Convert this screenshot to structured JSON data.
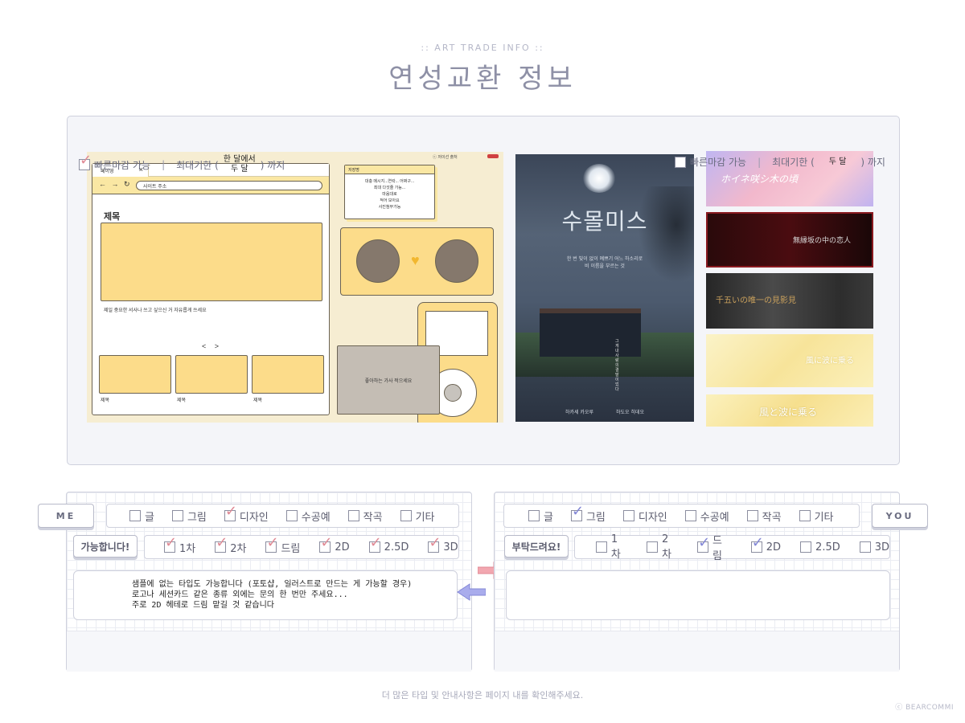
{
  "header": {
    "subtitle": ":: ART TRADE INFO ::",
    "title": "연성교환 정보"
  },
  "samples": {
    "mockup": {
      "copyright": "ⓒ 저이선 출처",
      "tab_label": "페이영",
      "url_text": "사이트 주소",
      "page_title": "제목",
      "description": "제일 중요한 서사나 쓰고 싶으신 거 자유롭게 쓰세요",
      "pager": "<  >",
      "thumb_labels": [
        "제목",
        "제목",
        "제목"
      ],
      "memo_title": "저장명",
      "memo_body": "대충 메시지...연락... 어쩌구...\n최대 다섯줄 가능...\n마음대로\n적어 보아요\n사진첨부가능",
      "lyric_box": "좋아하는 가사 적으세요"
    },
    "poster": {
      "title": "수몰미스",
      "tagline": "한 번 빛이 없이 예쁘기 어느 하소리로\n비 이름을 부르는 것",
      "vertical_text": "그게 내 사랑의 결말이었다",
      "credits": [
        "하카세 카오루",
        "하도오 히데오"
      ]
    },
    "banners": [
      "ホイネ咲シ木の頃",
      "無縁坂の中の恋人",
      "千五いの唯一の見影見",
      "風に波に乗る",
      "風と波に乗る"
    ]
  },
  "me_panel": {
    "label": "ME",
    "types": [
      {
        "label": "글",
        "checked": false
      },
      {
        "label": "그림",
        "checked": false
      },
      {
        "label": "디자인",
        "checked": true
      },
      {
        "label": "수공예",
        "checked": false
      },
      {
        "label": "작곡",
        "checked": false
      },
      {
        "label": "기타",
        "checked": false
      }
    ],
    "status_label": "가능합니다!",
    "styles": [
      {
        "label": "1차",
        "checked": true
      },
      {
        "label": "2차",
        "checked": true
      },
      {
        "label": "드림",
        "checked": true
      },
      {
        "label": "2D",
        "checked": true
      },
      {
        "label": "2.5D",
        "checked": true
      },
      {
        "label": "3D",
        "checked": true
      }
    ],
    "note": "샘플에 없는 타입도 가능합니다 (포토샵, 일러스트로 만드는 게 가능할 경우)\n로고나 세션카드 같은 종류 외에는 문의 한 번만 주세요...\n주로 2D 헤테로 드림 맡길 것 같습니다",
    "fast_deadline_label": "빠른마감 가능",
    "fast_deadline_checked": true,
    "max_deadline_prefix": "최대기한 (",
    "max_deadline_value": "한 달에서\n두 달",
    "max_deadline_suffix": ") 까지"
  },
  "you_panel": {
    "label": "YOU",
    "types": [
      {
        "label": "글",
        "checked": false
      },
      {
        "label": "그림",
        "checked": true
      },
      {
        "label": "디자인",
        "checked": false
      },
      {
        "label": "수공예",
        "checked": false
      },
      {
        "label": "작곡",
        "checked": false
      },
      {
        "label": "기타",
        "checked": false
      }
    ],
    "status_label": "부탁드려요!",
    "styles": [
      {
        "label": "1차",
        "checked": false
      },
      {
        "label": "2차",
        "checked": false
      },
      {
        "label": "드림",
        "checked": true
      },
      {
        "label": "2D",
        "checked": true
      },
      {
        "label": "2.5D",
        "checked": false
      },
      {
        "label": "3D",
        "checked": false
      }
    ],
    "note": "",
    "fast_deadline_label": "빠른마감 가능",
    "fast_deadline_checked": false,
    "max_deadline_prefix": "최대기한 (",
    "max_deadline_value": "두 달",
    "max_deadline_suffix": ") 까지"
  },
  "footer": {
    "note": "더 많은 타입 및 안내사항은 페이지 내를 확인해주세요.",
    "credit": "ⓒ BEARCOMMI"
  },
  "colors": {
    "me_check": "#e08a95",
    "you_check": "#8387d6",
    "accent_text": "#8e90a6"
  }
}
